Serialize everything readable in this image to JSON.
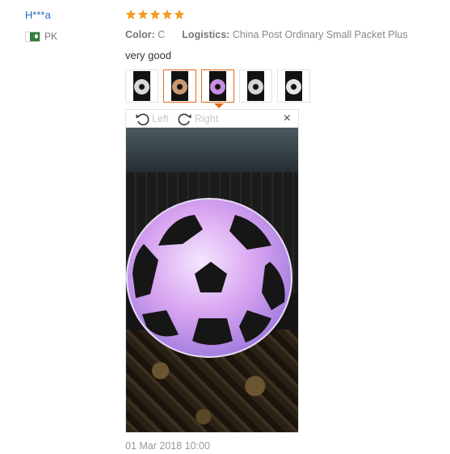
{
  "review": {
    "user_name": "H***a",
    "country_code": "PK",
    "rating": 5,
    "color_label": "Color:",
    "color_value": "C",
    "logistics_label": "Logistics:",
    "logistics_value": "China Post Ordinary Small Packet Plus",
    "text": "very good",
    "date": "01 Mar 2018 10:00"
  },
  "thumbnails": [
    {
      "name": "photo-1",
      "active": false,
      "ball_color": "#d9d9d9"
    },
    {
      "name": "photo-2",
      "active": true,
      "ball_color": "#c99a72"
    },
    {
      "name": "photo-3",
      "active": true,
      "ball_color": "#c98ee0"
    },
    {
      "name": "photo-4",
      "active": false,
      "ball_color": "#d5d5d5"
    },
    {
      "name": "photo-5",
      "active": false,
      "ball_color": "#e5e5e5"
    }
  ],
  "viewer": {
    "rotate_left_label": "Left",
    "rotate_right_label": "Right",
    "close_symbol": "×"
  },
  "colors": {
    "star": "#f39c1f",
    "link": "#2a6ab8",
    "accent": "#e06a1b"
  },
  "icons": {
    "flag": "pakistan-flag-icon",
    "rotate_left": "rotate-left-icon",
    "rotate_right": "rotate-right-icon",
    "close": "close-icon"
  }
}
